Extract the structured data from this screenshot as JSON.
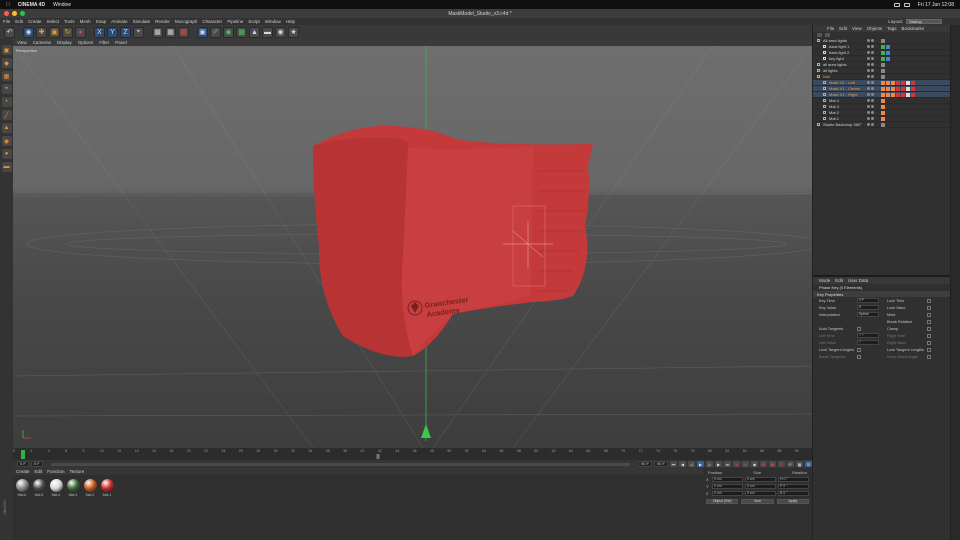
{
  "mac_menu": {
    "app": "CINEMA 4D",
    "items": [
      "Window"
    ],
    "clock": "Fri 17 Jun 12:08"
  },
  "window": {
    "title": "MaskModel_Studio_v3.c4d *"
  },
  "menubar": {
    "items": [
      "File",
      "Edit",
      "Create",
      "Select",
      "Tools",
      "Mesh",
      "Snap",
      "Animate",
      "Simulate",
      "Render",
      "Mocograph",
      "Character",
      "Pipeline",
      "Script",
      "Window",
      "Help"
    ],
    "layout_label": "Layout:",
    "layout_value": "Startup"
  },
  "viewport_menu": {
    "items": [
      "View",
      "Cameras",
      "Display",
      "Options",
      "Filter",
      "Panel"
    ],
    "camera_label": "Perspective"
  },
  "model": {
    "logo_line1": "Granchester",
    "logo_line2": "Academy",
    "mask_color": "#c43a3a"
  },
  "timeline": {
    "frames": [
      "0",
      "2",
      "4",
      "6",
      "8",
      "10",
      "12",
      "14",
      "16",
      "18",
      "20",
      "22",
      "24",
      "26",
      "28",
      "30",
      "32",
      "34",
      "36",
      "38",
      "40",
      "42",
      "44",
      "46",
      "48",
      "50",
      "52",
      "54",
      "56",
      "58",
      "60",
      "62",
      "64",
      "66",
      "68",
      "70",
      "72",
      "74",
      "76",
      "78",
      "80",
      "82",
      "84",
      "86",
      "88",
      "90"
    ],
    "current_frame": "0 F",
    "start_field": "0 F",
    "end_field": "90 F",
    "max_field": "90 F",
    "playhead_fraction": 0.01,
    "marker_fraction": 0.455
  },
  "material_manager": {
    "menu": [
      "Create",
      "Edit",
      "Function",
      "Texture"
    ],
    "materials": [
      {
        "name": "Mat.6",
        "color": "#8a8a8a"
      },
      {
        "name": "Mat.5",
        "color": "#4d4d4d"
      },
      {
        "name": "Mat.4",
        "color": "#d9d9d9"
      },
      {
        "name": "Mat.3",
        "color": "#3c6a3c"
      },
      {
        "name": "Mat.2",
        "color": "#c85a1f"
      },
      {
        "name": "Mat.1",
        "color": "#c92d2d"
      }
    ]
  },
  "coordinates": {
    "headers": [
      "Position",
      "Size",
      "Rotation"
    ],
    "rows": [
      {
        "axis": "X",
        "pos": "0 cm",
        "size": "0 cm",
        "rot": "H 0 °"
      },
      {
        "axis": "Y",
        "pos": "0 cm",
        "size": "0 cm",
        "rot": "P 0 °"
      },
      {
        "axis": "Z",
        "pos": "0 cm",
        "size": "0 cm",
        "rot": "B 0 °"
      }
    ],
    "mode_select": "Object (Rel)",
    "size_select": "Size",
    "apply": "Apply"
  },
  "object_manager": {
    "menu": [
      "File",
      "Edit",
      "View",
      "Objects",
      "Tags",
      "Bookmarks"
    ],
    "rows": [
      {
        "name": "All area lights",
        "indent": 4,
        "kind": "group"
      },
      {
        "name": "back light 1",
        "indent": 10,
        "kind": "light"
      },
      {
        "name": "back light 2",
        "indent": 10,
        "kind": "light"
      },
      {
        "name": "key light",
        "indent": 10,
        "kind": "light"
      },
      {
        "name": "all area lights",
        "indent": 4,
        "kind": "group"
      },
      {
        "name": "all lights",
        "indent": 4,
        "kind": "group"
      },
      {
        "name": "Null",
        "indent": 4,
        "kind": "null-orange"
      },
      {
        "name": "Mask.V1 - Left",
        "indent": 10,
        "kind": "mask"
      },
      {
        "name": "Mask.V1 - Center",
        "indent": 10,
        "kind": "mask"
      },
      {
        "name": "Mask.V1 - Right",
        "indent": 10,
        "kind": "mask"
      },
      {
        "name": "Mat.4",
        "indent": 10,
        "kind": "plain"
      },
      {
        "name": "Mat.3",
        "indent": 10,
        "kind": "plain"
      },
      {
        "name": "Mat.2",
        "indent": 10,
        "kind": "plain"
      },
      {
        "name": "Mat.1",
        "indent": 10,
        "kind": "plain"
      },
      {
        "name": "Studio Backdrop 360°",
        "indent": 4,
        "kind": "group"
      }
    ]
  },
  "attribute_manager": {
    "menu": [
      "Mode",
      "Edit",
      "User Data"
    ],
    "header": "Phase Key (0 Elements)",
    "tab": "Key Properties",
    "rows": [
      {
        "l": "Key Time",
        "v": "0 F",
        "l2": "Lock Time",
        "dim": false
      },
      {
        "l": "Key Value",
        "v": "0",
        "l2": "Lock Value",
        "dim": false
      },
      {
        "l": "Interpolation",
        "v": "Spline",
        "l2": "Mute",
        "dim": false
      },
      {
        "l": "",
        "v": "",
        "l2": "Break Rotation",
        "dim": false
      },
      {
        "l": "Auto Tangents",
        "v": "",
        "l2": "Clamp",
        "dim": false
      },
      {
        "l": "Left Time",
        "v": "0 F",
        "l2": "Right Time",
        "dim": true
      },
      {
        "l": "Left Value",
        "v": "0",
        "l2": "Right Value",
        "dim": true
      },
      {
        "l": "Lock Tangent Angles",
        "v": "",
        "l2": "Lock Tangent Lengths",
        "dim": false
      },
      {
        "l": "Break Tangents",
        "v": "",
        "l2": "Keep Visual Angle",
        "dim": true
      }
    ]
  },
  "side_label": "MAXON"
}
